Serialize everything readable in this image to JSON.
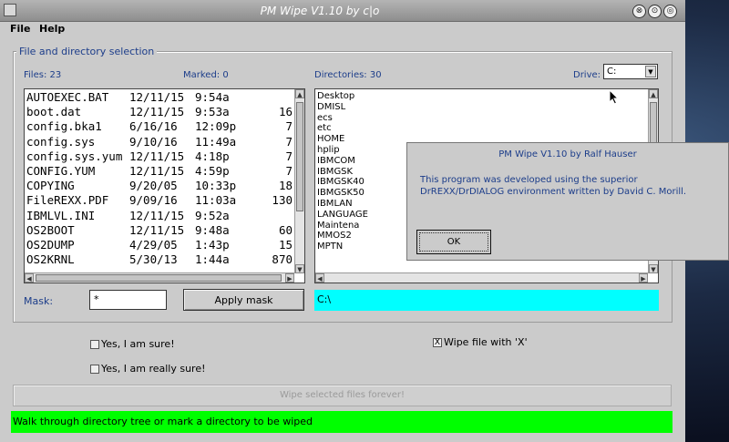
{
  "window": {
    "title": "PM Wipe V1.10 by c|o"
  },
  "menu": {
    "file": "File",
    "help": "Help"
  },
  "selection": {
    "group_title": "File and directory selection",
    "files_label": "Files: 23",
    "marked_label": "Marked: 0",
    "directories_label": "Directories: 30",
    "drive_label": "Drive:",
    "drive_value": "C:"
  },
  "files": [
    {
      "name": "AUTOEXEC.BAT",
      "date": "12/11/15",
      "time": "9:54a",
      "size": ""
    },
    {
      "name": "boot.dat",
      "date": "12/11/15",
      "time": "9:53a",
      "size": "16"
    },
    {
      "name": "config.bka1",
      "date": "6/16/16",
      "time": "12:09p",
      "size": "7"
    },
    {
      "name": "config.sys",
      "date": "9/10/16",
      "time": "11:49a",
      "size": "7"
    },
    {
      "name": "config.sys.yum",
      "date": "12/11/15",
      "time": "4:18p",
      "size": "7"
    },
    {
      "name": "CONFIG.YUM",
      "date": "12/11/15",
      "time": "4:59p",
      "size": "7"
    },
    {
      "name": "COPYING",
      "date": "9/20/05",
      "time": "10:33p",
      "size": "18"
    },
    {
      "name": "FileREXX.PDF",
      "date": "9/09/16",
      "time": "11:03a",
      "size": "130"
    },
    {
      "name": "IBMLVL.INI",
      "date": "12/11/15",
      "time": "9:52a",
      "size": ""
    },
    {
      "name": "OS2BOOT",
      "date": "12/11/15",
      "time": "9:48a",
      "size": "60"
    },
    {
      "name": "OS2DUMP",
      "date": "4/29/05",
      "time": "1:43p",
      "size": "15"
    },
    {
      "name": "OS2KRNL",
      "date": "5/30/13",
      "time": "1:44a",
      "size": "870"
    }
  ],
  "directories": [
    "Desktop",
    "DMISL",
    "ecs",
    "etc",
    "HOME",
    "hplip",
    "IBMCOM",
    "IBMGSK",
    "IBMGSK40",
    "IBMGSK50",
    "IBMLAN",
    "LANGUAGE",
    "Maintena",
    "MMOS2",
    "MPTN"
  ],
  "mask": {
    "label": "Mask:",
    "value": "*",
    "apply_label": "Apply mask"
  },
  "current_path": "C:\\",
  "options": {
    "sure_label": "Yes, I am sure!",
    "really_sure_label": "Yes, I am really sure!",
    "wipe_x_label": "Wipe file with 'X'",
    "wipe_x_mark": "X"
  },
  "wipe_button_label": "Wipe selected files forever!",
  "status_text": "Walk through directory tree or mark a directory to be wiped",
  "about_dialog": {
    "title": "PM Wipe V1.10 by Ralf Hauser",
    "text": "This program was developed using the superior DrREXX/DrDIALOG environment written by David C. Morill.",
    "ok_label": "OK"
  },
  "colors": {
    "path_bar": "#00ffff",
    "status_bar": "#00ff00",
    "group_label": "#1c3d8a"
  }
}
